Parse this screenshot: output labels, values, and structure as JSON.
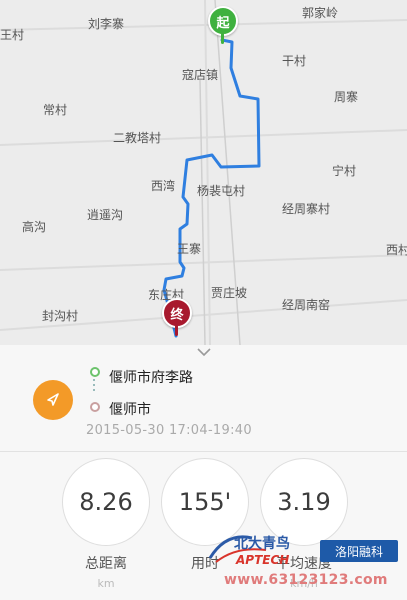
{
  "map": {
    "places": [
      {
        "id": "liulizhai",
        "label": "刘李寨"
      },
      {
        "id": "guojialing",
        "label": "郭家岭"
      },
      {
        "id": "wangcun",
        "label": "王村"
      },
      {
        "id": "koudianzhen",
        "label": "寇店镇"
      },
      {
        "id": "gancun",
        "label": "干村"
      },
      {
        "id": "changcun",
        "label": "常村"
      },
      {
        "id": "zhouzhai",
        "label": "周寨"
      },
      {
        "id": "erjiaotacun",
        "label": "二教塔村"
      },
      {
        "id": "ningcun",
        "label": "宁村"
      },
      {
        "id": "xiwan",
        "label": "西湾"
      },
      {
        "id": "yangpeitun",
        "label": "杨裴屯村"
      },
      {
        "id": "jingzhouzhaicun",
        "label": "经周寨村"
      },
      {
        "id": "xiaoyaogou",
        "label": "逍遥沟"
      },
      {
        "id": "gaogou",
        "label": "高沟"
      },
      {
        "id": "wangzhai",
        "label": "王寨"
      },
      {
        "id": "xicun",
        "label": "西村"
      },
      {
        "id": "dongzhuangcun",
        "label": "东庄村"
      },
      {
        "id": "jiazhuangpo",
        "label": "贾庄坡"
      },
      {
        "id": "jingzhounanyao",
        "label": "经周南窑"
      },
      {
        "id": "fenggoucun",
        "label": "封沟村"
      }
    ],
    "start_marker": "起",
    "end_marker": "终",
    "colors": {
      "route": "#2f7fe0",
      "start": "#3fb13f",
      "end": "#a8192e"
    }
  },
  "trip": {
    "start_address": "偃师市府李路",
    "end_address": "偃师市",
    "datetime": "2015-05-30 17:04-19:40"
  },
  "stats": [
    {
      "id": "distance",
      "value": "8.26",
      "label": "总距离",
      "unit": "km"
    },
    {
      "id": "duration",
      "value": "155'",
      "label": "用时",
      "unit": ""
    },
    {
      "id": "speed",
      "value": "3.19",
      "label": "平均速度",
      "unit": "km/h"
    }
  ],
  "watermark": {
    "brand": "北大青鸟",
    "brand_sub": "APTECH",
    "badge": "洛阳融科",
    "url": "www.63123123.com"
  },
  "icons": {
    "collapse": "chevron-down-icon",
    "navigate": "navigation-arrow-icon"
  }
}
